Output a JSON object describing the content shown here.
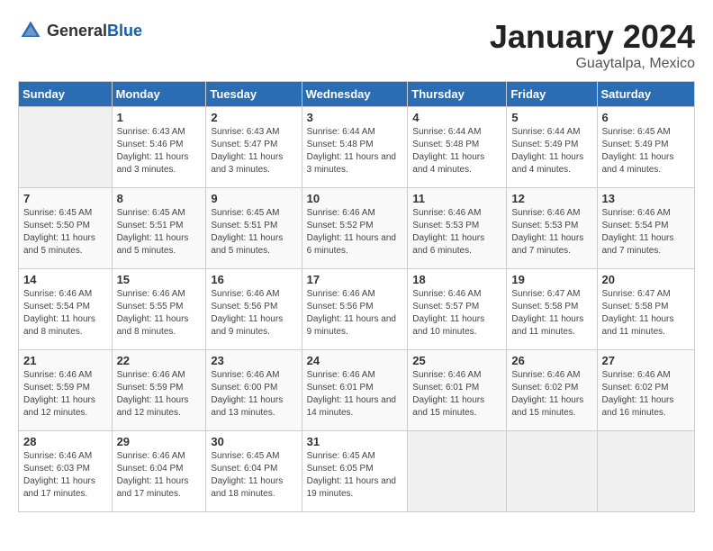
{
  "header": {
    "logo_general": "General",
    "logo_blue": "Blue",
    "title": "January 2024",
    "location": "Guaytalpa, Mexico"
  },
  "columns": [
    "Sunday",
    "Monday",
    "Tuesday",
    "Wednesday",
    "Thursday",
    "Friday",
    "Saturday"
  ],
  "weeks": [
    [
      {
        "day": "",
        "sunrise": "",
        "sunset": "",
        "daylight": ""
      },
      {
        "day": "1",
        "sunrise": "Sunrise: 6:43 AM",
        "sunset": "Sunset: 5:46 PM",
        "daylight": "Daylight: 11 hours and 3 minutes."
      },
      {
        "day": "2",
        "sunrise": "Sunrise: 6:43 AM",
        "sunset": "Sunset: 5:47 PM",
        "daylight": "Daylight: 11 hours and 3 minutes."
      },
      {
        "day": "3",
        "sunrise": "Sunrise: 6:44 AM",
        "sunset": "Sunset: 5:48 PM",
        "daylight": "Daylight: 11 hours and 3 minutes."
      },
      {
        "day": "4",
        "sunrise": "Sunrise: 6:44 AM",
        "sunset": "Sunset: 5:48 PM",
        "daylight": "Daylight: 11 hours and 4 minutes."
      },
      {
        "day": "5",
        "sunrise": "Sunrise: 6:44 AM",
        "sunset": "Sunset: 5:49 PM",
        "daylight": "Daylight: 11 hours and 4 minutes."
      },
      {
        "day": "6",
        "sunrise": "Sunrise: 6:45 AM",
        "sunset": "Sunset: 5:49 PM",
        "daylight": "Daylight: 11 hours and 4 minutes."
      }
    ],
    [
      {
        "day": "7",
        "sunrise": "Sunrise: 6:45 AM",
        "sunset": "Sunset: 5:50 PM",
        "daylight": "Daylight: 11 hours and 5 minutes."
      },
      {
        "day": "8",
        "sunrise": "Sunrise: 6:45 AM",
        "sunset": "Sunset: 5:51 PM",
        "daylight": "Daylight: 11 hours and 5 minutes."
      },
      {
        "day": "9",
        "sunrise": "Sunrise: 6:45 AM",
        "sunset": "Sunset: 5:51 PM",
        "daylight": "Daylight: 11 hours and 5 minutes."
      },
      {
        "day": "10",
        "sunrise": "Sunrise: 6:46 AM",
        "sunset": "Sunset: 5:52 PM",
        "daylight": "Daylight: 11 hours and 6 minutes."
      },
      {
        "day": "11",
        "sunrise": "Sunrise: 6:46 AM",
        "sunset": "Sunset: 5:53 PM",
        "daylight": "Daylight: 11 hours and 6 minutes."
      },
      {
        "day": "12",
        "sunrise": "Sunrise: 6:46 AM",
        "sunset": "Sunset: 5:53 PM",
        "daylight": "Daylight: 11 hours and 7 minutes."
      },
      {
        "day": "13",
        "sunrise": "Sunrise: 6:46 AM",
        "sunset": "Sunset: 5:54 PM",
        "daylight": "Daylight: 11 hours and 7 minutes."
      }
    ],
    [
      {
        "day": "14",
        "sunrise": "Sunrise: 6:46 AM",
        "sunset": "Sunset: 5:54 PM",
        "daylight": "Daylight: 11 hours and 8 minutes."
      },
      {
        "day": "15",
        "sunrise": "Sunrise: 6:46 AM",
        "sunset": "Sunset: 5:55 PM",
        "daylight": "Daylight: 11 hours and 8 minutes."
      },
      {
        "day": "16",
        "sunrise": "Sunrise: 6:46 AM",
        "sunset": "Sunset: 5:56 PM",
        "daylight": "Daylight: 11 hours and 9 minutes."
      },
      {
        "day": "17",
        "sunrise": "Sunrise: 6:46 AM",
        "sunset": "Sunset: 5:56 PM",
        "daylight": "Daylight: 11 hours and 9 minutes."
      },
      {
        "day": "18",
        "sunrise": "Sunrise: 6:46 AM",
        "sunset": "Sunset: 5:57 PM",
        "daylight": "Daylight: 11 hours and 10 minutes."
      },
      {
        "day": "19",
        "sunrise": "Sunrise: 6:47 AM",
        "sunset": "Sunset: 5:58 PM",
        "daylight": "Daylight: 11 hours and 11 minutes."
      },
      {
        "day": "20",
        "sunrise": "Sunrise: 6:47 AM",
        "sunset": "Sunset: 5:58 PM",
        "daylight": "Daylight: 11 hours and 11 minutes."
      }
    ],
    [
      {
        "day": "21",
        "sunrise": "Sunrise: 6:46 AM",
        "sunset": "Sunset: 5:59 PM",
        "daylight": "Daylight: 11 hours and 12 minutes."
      },
      {
        "day": "22",
        "sunrise": "Sunrise: 6:46 AM",
        "sunset": "Sunset: 5:59 PM",
        "daylight": "Daylight: 11 hours and 12 minutes."
      },
      {
        "day": "23",
        "sunrise": "Sunrise: 6:46 AM",
        "sunset": "Sunset: 6:00 PM",
        "daylight": "Daylight: 11 hours and 13 minutes."
      },
      {
        "day": "24",
        "sunrise": "Sunrise: 6:46 AM",
        "sunset": "Sunset: 6:01 PM",
        "daylight": "Daylight: 11 hours and 14 minutes."
      },
      {
        "day": "25",
        "sunrise": "Sunrise: 6:46 AM",
        "sunset": "Sunset: 6:01 PM",
        "daylight": "Daylight: 11 hours and 15 minutes."
      },
      {
        "day": "26",
        "sunrise": "Sunrise: 6:46 AM",
        "sunset": "Sunset: 6:02 PM",
        "daylight": "Daylight: 11 hours and 15 minutes."
      },
      {
        "day": "27",
        "sunrise": "Sunrise: 6:46 AM",
        "sunset": "Sunset: 6:02 PM",
        "daylight": "Daylight: 11 hours and 16 minutes."
      }
    ],
    [
      {
        "day": "28",
        "sunrise": "Sunrise: 6:46 AM",
        "sunset": "Sunset: 6:03 PM",
        "daylight": "Daylight: 11 hours and 17 minutes."
      },
      {
        "day": "29",
        "sunrise": "Sunrise: 6:46 AM",
        "sunset": "Sunset: 6:04 PM",
        "daylight": "Daylight: 11 hours and 17 minutes."
      },
      {
        "day": "30",
        "sunrise": "Sunrise: 6:45 AM",
        "sunset": "Sunset: 6:04 PM",
        "daylight": "Daylight: 11 hours and 18 minutes."
      },
      {
        "day": "31",
        "sunrise": "Sunrise: 6:45 AM",
        "sunset": "Sunset: 6:05 PM",
        "daylight": "Daylight: 11 hours and 19 minutes."
      },
      {
        "day": "",
        "sunrise": "",
        "sunset": "",
        "daylight": ""
      },
      {
        "day": "",
        "sunrise": "",
        "sunset": "",
        "daylight": ""
      },
      {
        "day": "",
        "sunrise": "",
        "sunset": "",
        "daylight": ""
      }
    ]
  ]
}
